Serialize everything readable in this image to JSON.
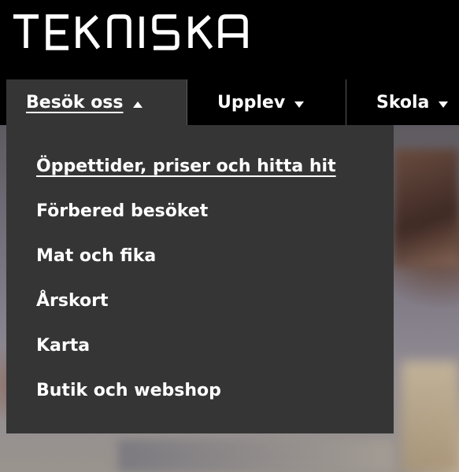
{
  "header": {
    "logo_text": "TEKNISKA"
  },
  "nav": {
    "items": [
      {
        "label": "Besök oss",
        "caret": "caret-up"
      },
      {
        "label": "Upplev",
        "caret": "caret-down"
      },
      {
        "label": "Skola",
        "caret": "caret-down"
      }
    ]
  },
  "dropdown": {
    "items": [
      {
        "label": "Öppettider, priser och hitta hit"
      },
      {
        "label": "Förbered besöket"
      },
      {
        "label": "Mat och fika"
      },
      {
        "label": "Årskort"
      },
      {
        "label": "Karta"
      },
      {
        "label": "Butik och webshop"
      }
    ]
  },
  "colors": {
    "header_bg": "#000000",
    "active_bg": "#353535",
    "text": "#ffffff"
  }
}
